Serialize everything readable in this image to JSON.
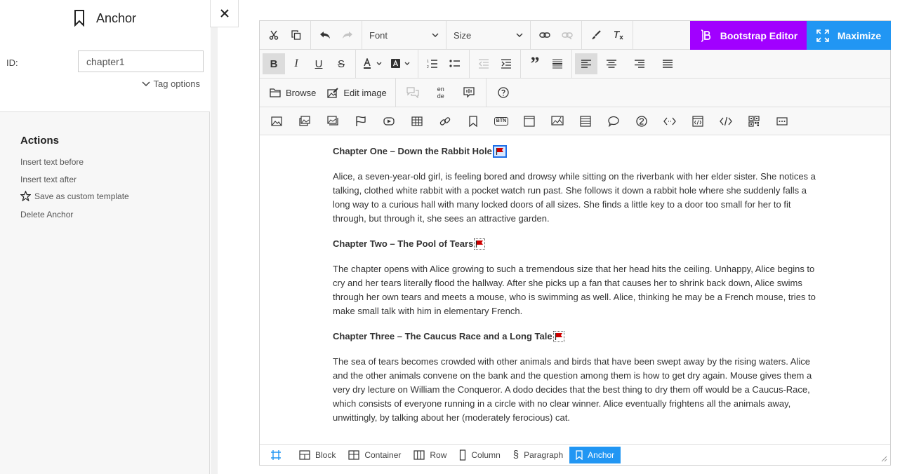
{
  "sidebar": {
    "title": "Anchor",
    "id_label": "ID:",
    "id_value": "chapter1",
    "tag_options": "Tag options",
    "actions_title": "Actions",
    "actions": [
      {
        "label": "Insert text before"
      },
      {
        "label": "Insert text after"
      },
      {
        "label": "Save as custom template"
      },
      {
        "label": "Delete Anchor"
      }
    ]
  },
  "toolbar": {
    "font_label": "Font",
    "size_label": "Size",
    "bootstrap_label": "Bootstrap Editor",
    "maximize_label": "Maximize",
    "browse_label": "Browse",
    "edit_image_label": "Edit image",
    "lang_top": "en",
    "lang_bottom": "de",
    "btn_badge": "BTN"
  },
  "content": {
    "chapters": [
      {
        "title": "Chapter One – Down the Rabbit Hole",
        "text": "Alice, a seven-year-old girl, is feeling bored and drowsy while sitting on the riverbank with her elder sister. She notices a talking, clothed white rabbit with a pocket watch run past. She follows it down a rabbit hole where she suddenly falls a long way to a curious hall with many locked doors of all sizes. She finds a little key to a door too small for her to fit through, but through it, she sees an attractive garden."
      },
      {
        "title": "Chapter Two – The Pool of Tears",
        "text": "The chapter opens with Alice growing to such a tremendous size that her head hits the ceiling. Unhappy, Alice begins to cry and her tears literally flood the hallway. After she picks up a fan that causes her to shrink back down, Alice swims through her own tears and meets a mouse, who is swimming as well. Alice, thinking he may be a French mouse, tries to make small talk with him in elementary French."
      },
      {
        "title": "Chapter Three – The Caucus Race and a Long Tale",
        "text": "The sea of tears becomes crowded with other animals and birds that have been swept away by the rising waters. Alice and the other animals convene on the bank and the question among them is how to get dry again. Mouse gives them a very dry lecture on William the Conqueror. A dodo decides that the best thing to dry them off would be a Caucus-Race, which consists of everyone running in a circle with no clear winner. Alice eventually frightens all the animals away, unwittingly, by talking about her (moderately ferocious) cat."
      }
    ]
  },
  "statusbar": {
    "crumbs": [
      {
        "label": "Block"
      },
      {
        "label": "Container"
      },
      {
        "label": "Row"
      },
      {
        "label": "Column"
      },
      {
        "label": "Paragraph"
      },
      {
        "label": "Anchor"
      }
    ]
  },
  "colors": {
    "bootstrap": "#a100ff",
    "maximize": "#2196f3",
    "anchor_flag": "#cc0000"
  }
}
